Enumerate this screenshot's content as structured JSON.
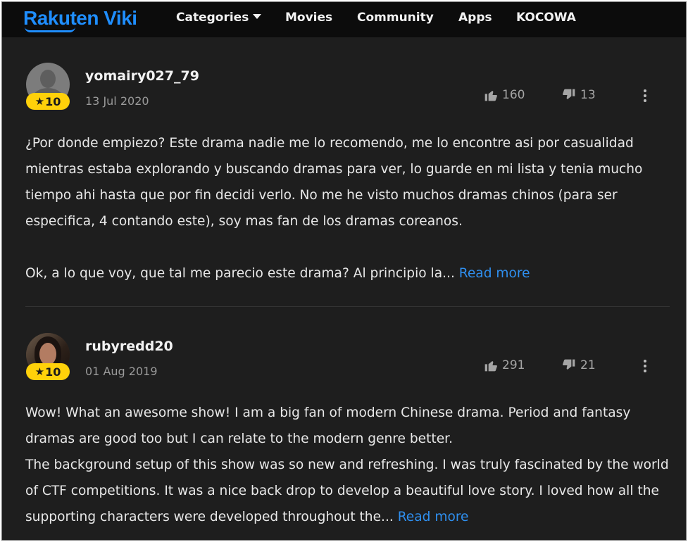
{
  "header": {
    "logo_text": "Rakuten Viki",
    "nav": [
      {
        "label": "Categories",
        "has_dropdown": true
      },
      {
        "label": "Movies"
      },
      {
        "label": "Community"
      },
      {
        "label": "Apps"
      },
      {
        "label": "KOCOWA"
      }
    ]
  },
  "colors": {
    "background": "#1e1e1e",
    "topbar": "#0c0c0c",
    "brand": "#1f8eff",
    "badge": "#ffd10a",
    "link": "#2f8fef"
  },
  "reviews": [
    {
      "username": "yomairy027_79",
      "date": "13 Jul 2020",
      "rating": "10",
      "avatar": "default-avatar-icon",
      "likes": "160",
      "dislikes": "13",
      "paragraphs": [
        "¿Por donde empiezo? Este drama nadie me lo recomendo, me lo encontre asi por casualidad mientras estaba explorando y buscando dramas para ver, lo guarde en mi lista y tenia mucho tiempo ahi hasta que por fin decidi verlo. No me he visto muchos dramas chinos (para ser especifica, 4 contando este), soy mas fan de los dramas coreanos.",
        "Ok, a lo que voy, que tal me parecio este drama? Al principio la..."
      ],
      "read_more": "Read more"
    },
    {
      "username": "rubyredd20",
      "date": "01 Aug 2019",
      "rating": "10",
      "avatar": "user-photo",
      "likes": "291",
      "dislikes": "21",
      "paragraphs": [
        "Wow! What an awesome show! I am a big fan of modern Chinese drama. Period and fantasy dramas are good too but I can relate to the modern genre better.",
        "The background setup of this show was so new and refreshing. I was truly fascinated by the world of CTF competitions. It was a nice back drop to develop a beautiful love story. I loved how all the supporting characters were developed throughout the..."
      ],
      "read_more": "Read more"
    }
  ]
}
